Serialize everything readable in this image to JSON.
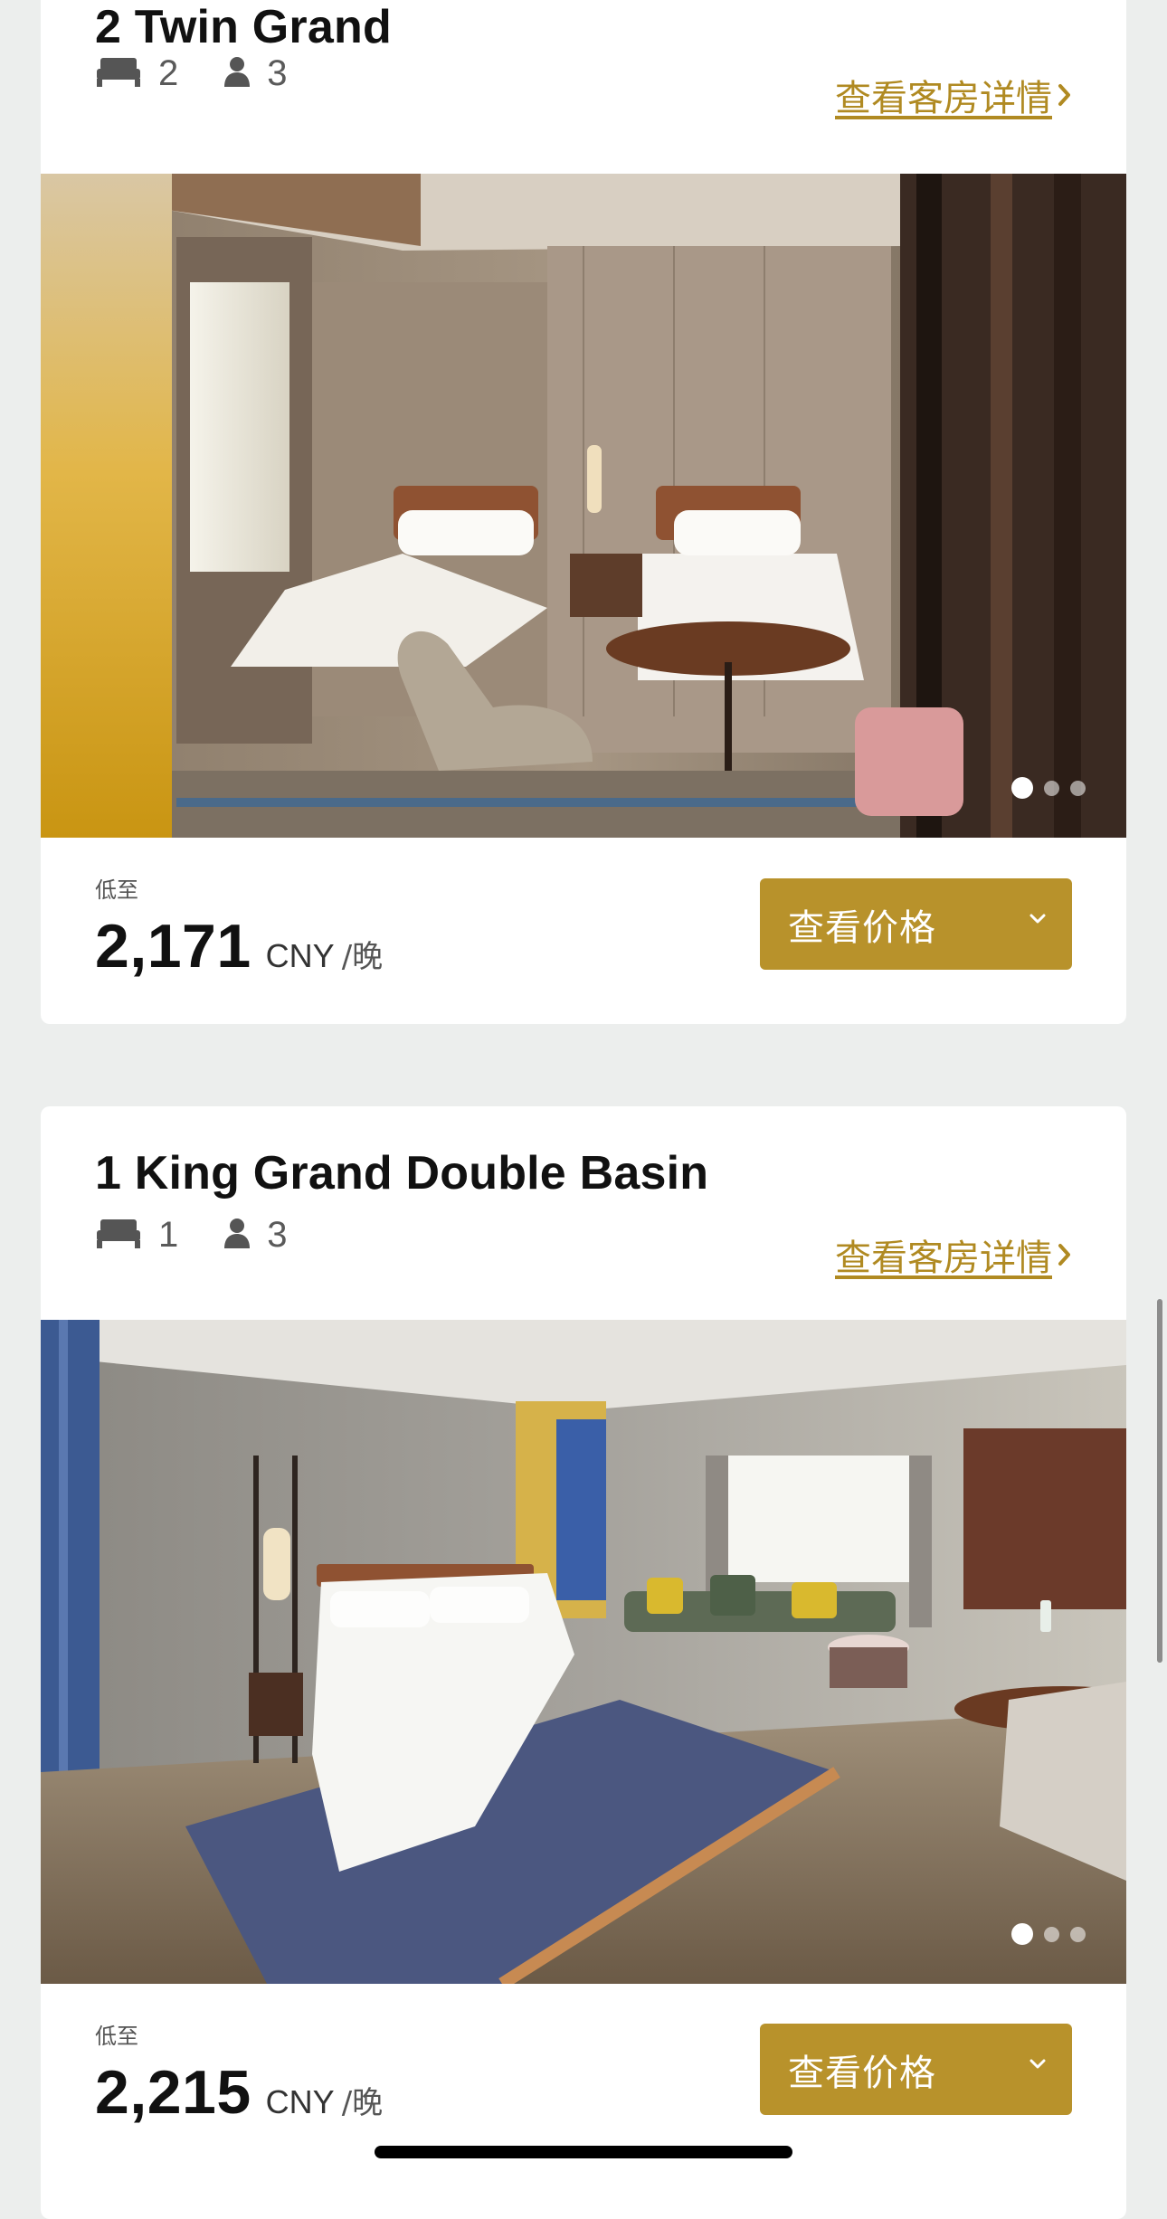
{
  "rooms": [
    {
      "name": "2 Twin Grand",
      "beds": "2",
      "guests": "3",
      "details_link": "查看客房详情",
      "carousel_active_index": 0,
      "carousel_count": 3,
      "price_from_label": "低至",
      "price": "2,171",
      "currency": "CNY",
      "unit": "/晚",
      "view_price_button": "查看价格"
    },
    {
      "name": "1 King Grand Double Basin",
      "beds": "1",
      "guests": "3",
      "details_link": "查看客房详情",
      "carousel_active_index": 0,
      "carousel_count": 3,
      "price_from_label": "低至",
      "price": "2,215",
      "currency": "CNY",
      "unit": "/晚",
      "view_price_button": "查看价格"
    }
  ],
  "icons": {
    "bed": "bed-icon",
    "guest": "person-icon",
    "link_chevron": "chevron-right-icon",
    "button_chevron": "chevron-down-icon"
  },
  "colors": {
    "accent": "#b8922b",
    "link": "#b08a22",
    "background": "#eceeed",
    "card": "#ffffff"
  }
}
